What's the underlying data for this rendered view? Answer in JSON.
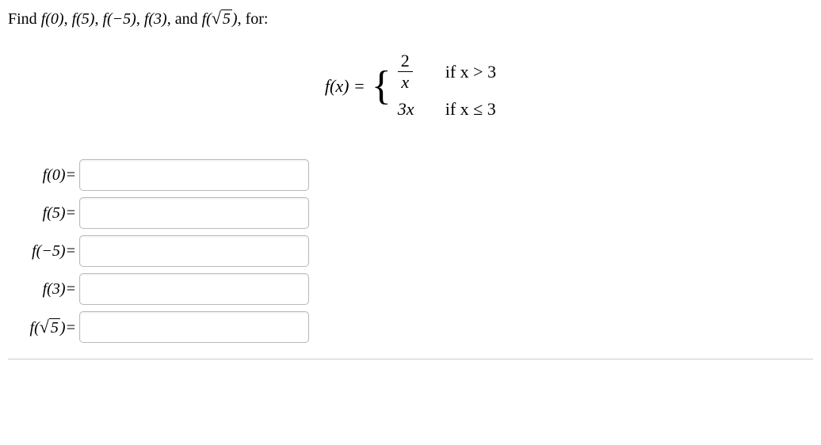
{
  "prompt": {
    "prefix": "Find ",
    "f0": "f(0)",
    "f5": "f(5)",
    "fneg5": "f(−5)",
    "f3": "f(3)",
    "and": ", and ",
    "fsqrt5_f": "f(",
    "fsqrt5_sign": "√",
    "fsqrt5_arg": "5",
    "fsqrt5_close": ")",
    "suffix": ", for:"
  },
  "equation": {
    "lhs": "f(x) = ",
    "case1_num": "2",
    "case1_den": "x",
    "case1_cond": "if x > 3",
    "case2_expr": "3x",
    "case2_cond": "if x ≤ 3"
  },
  "answers": {
    "labels": {
      "f0": "f(0)=",
      "f5": "f(5)=",
      "fneg5": "f(−5)=",
      "f3": "f(3)=",
      "fsqrt5_f": "f(",
      "fsqrt5_sign": "√",
      "fsqrt5_arg": "5",
      "fsqrt5_close": ")="
    },
    "values": {
      "f0": "",
      "f5": "",
      "fneg5": "",
      "f3": "",
      "fsqrt5": ""
    }
  }
}
